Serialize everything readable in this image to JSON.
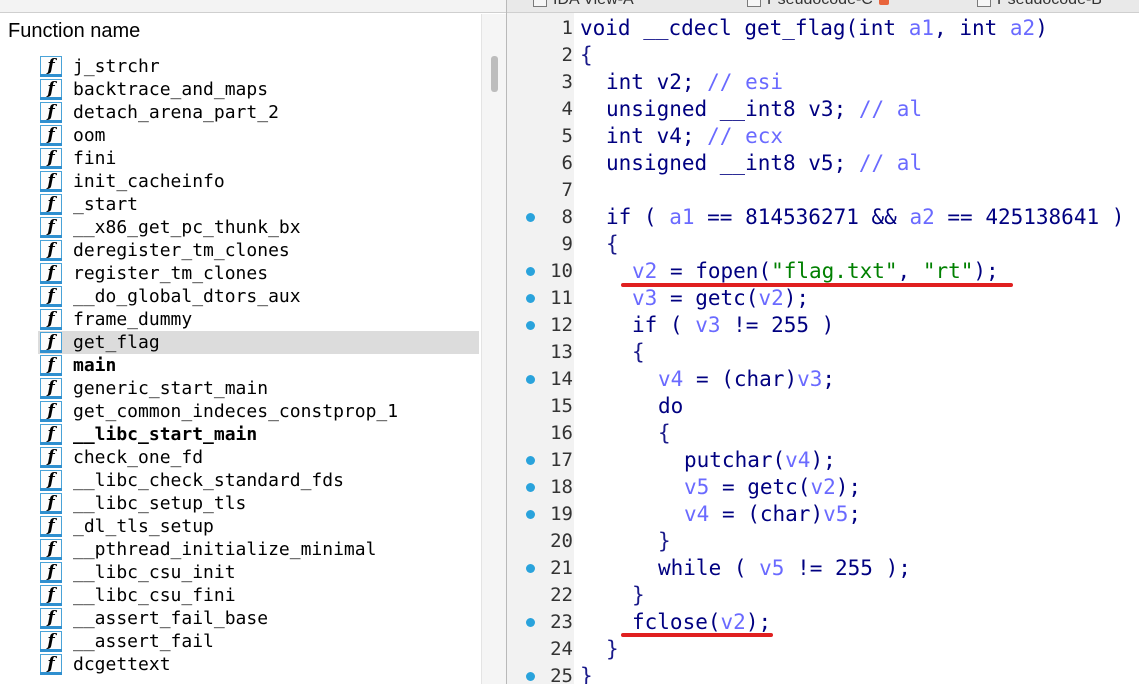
{
  "functions_window": {
    "header": "Function name",
    "icon_glyph": "f",
    "items": [
      {
        "name": "j_strchr",
        "bold": false,
        "selected": false
      },
      {
        "name": "backtrace_and_maps",
        "bold": false,
        "selected": false
      },
      {
        "name": "detach_arena_part_2",
        "bold": false,
        "selected": false
      },
      {
        "name": "oom",
        "bold": false,
        "selected": false
      },
      {
        "name": "fini",
        "bold": false,
        "selected": false
      },
      {
        "name": "init_cacheinfo",
        "bold": false,
        "selected": false
      },
      {
        "name": "_start",
        "bold": false,
        "selected": false
      },
      {
        "name": "__x86_get_pc_thunk_bx",
        "bold": false,
        "selected": false
      },
      {
        "name": "deregister_tm_clones",
        "bold": false,
        "selected": false
      },
      {
        "name": "register_tm_clones",
        "bold": false,
        "selected": false
      },
      {
        "name": "__do_global_dtors_aux",
        "bold": false,
        "selected": false
      },
      {
        "name": "frame_dummy",
        "bold": false,
        "selected": false
      },
      {
        "name": "get_flag",
        "bold": false,
        "selected": true
      },
      {
        "name": "main",
        "bold": true,
        "selected": false
      },
      {
        "name": "generic_start_main",
        "bold": false,
        "selected": false
      },
      {
        "name": "get_common_indeces_constprop_1",
        "bold": false,
        "selected": false
      },
      {
        "name": "__libc_start_main",
        "bold": true,
        "selected": false
      },
      {
        "name": "check_one_fd",
        "bold": false,
        "selected": false
      },
      {
        "name": "__libc_check_standard_fds",
        "bold": false,
        "selected": false
      },
      {
        "name": "__libc_setup_tls",
        "bold": false,
        "selected": false
      },
      {
        "name": "_dl_tls_setup",
        "bold": false,
        "selected": false
      },
      {
        "name": "__pthread_initialize_minimal",
        "bold": false,
        "selected": false
      },
      {
        "name": "__libc_csu_init",
        "bold": false,
        "selected": false
      },
      {
        "name": "__libc_csu_fini",
        "bold": false,
        "selected": false
      },
      {
        "name": "__assert_fail_base",
        "bold": false,
        "selected": false
      },
      {
        "name": "__assert_fail",
        "bold": false,
        "selected": false
      },
      {
        "name": "dcgettext",
        "bold": false,
        "selected": false
      }
    ]
  },
  "tabs": [
    {
      "label": "IDA View-A"
    },
    {
      "label": "Pseudocode-C"
    },
    {
      "label": "Pseudocode-B"
    }
  ],
  "pseudocode": {
    "lines": [
      {
        "n": "1",
        "bp": false,
        "indent": 0,
        "tokens": [
          [
            "kw",
            "void __cdecl get_flag(int "
          ],
          [
            "var",
            "a1"
          ],
          [
            "kw",
            ", int "
          ],
          [
            "var",
            "a2"
          ],
          [
            "kw",
            ")"
          ]
        ]
      },
      {
        "n": "2",
        "bp": false,
        "indent": 0,
        "tokens": [
          [
            "pn",
            "{"
          ]
        ]
      },
      {
        "n": "3",
        "bp": false,
        "indent": 1,
        "tokens": [
          [
            "kw",
            "int v2; "
          ],
          [
            "cm",
            "// esi"
          ]
        ]
      },
      {
        "n": "4",
        "bp": false,
        "indent": 1,
        "tokens": [
          [
            "kw",
            "unsigned __int8 v3; "
          ],
          [
            "cm",
            "// al"
          ]
        ]
      },
      {
        "n": "5",
        "bp": false,
        "indent": 1,
        "tokens": [
          [
            "kw",
            "int v4; "
          ],
          [
            "cm",
            "// ecx"
          ]
        ]
      },
      {
        "n": "6",
        "bp": false,
        "indent": 1,
        "tokens": [
          [
            "kw",
            "unsigned __int8 v5; "
          ],
          [
            "cm",
            "// al"
          ]
        ]
      },
      {
        "n": "7",
        "bp": false,
        "indent": 0,
        "tokens": []
      },
      {
        "n": "8",
        "bp": true,
        "indent": 1,
        "tokens": [
          [
            "kw",
            "if ( "
          ],
          [
            "var",
            "a1"
          ],
          [
            "kw",
            " == 814536271 && "
          ],
          [
            "var",
            "a2"
          ],
          [
            "kw",
            " == 425138641 )"
          ]
        ]
      },
      {
        "n": "9",
        "bp": false,
        "indent": 1,
        "tokens": [
          [
            "pn",
            "{"
          ]
        ]
      },
      {
        "n": "10",
        "bp": true,
        "indent": 2,
        "tokens": [
          [
            "var",
            "v2"
          ],
          [
            "kw",
            " = fopen("
          ],
          [
            "str",
            "\"flag.txt\""
          ],
          [
            "kw",
            ", "
          ],
          [
            "str",
            "\"rt\""
          ],
          [
            "kw",
            ");"
          ]
        ]
      },
      {
        "n": "11",
        "bp": true,
        "indent": 2,
        "tokens": [
          [
            "var",
            "v3"
          ],
          [
            "kw",
            " = getc("
          ],
          [
            "var",
            "v2"
          ],
          [
            "kw",
            ");"
          ]
        ]
      },
      {
        "n": "12",
        "bp": true,
        "indent": 2,
        "tokens": [
          [
            "kw",
            "if ( "
          ],
          [
            "var",
            "v3"
          ],
          [
            "kw",
            " != 255 )"
          ]
        ]
      },
      {
        "n": "13",
        "bp": false,
        "indent": 2,
        "tokens": [
          [
            "pn",
            "{"
          ]
        ]
      },
      {
        "n": "14",
        "bp": true,
        "indent": 3,
        "tokens": [
          [
            "var",
            "v4"
          ],
          [
            "kw",
            " = (char)"
          ],
          [
            "var",
            "v3"
          ],
          [
            "kw",
            ";"
          ]
        ]
      },
      {
        "n": "15",
        "bp": false,
        "indent": 3,
        "tokens": [
          [
            "kw",
            "do"
          ]
        ]
      },
      {
        "n": "16",
        "bp": false,
        "indent": 3,
        "tokens": [
          [
            "pn",
            "{"
          ]
        ]
      },
      {
        "n": "17",
        "bp": true,
        "indent": 4,
        "tokens": [
          [
            "kw",
            "putchar("
          ],
          [
            "var",
            "v4"
          ],
          [
            "kw",
            ");"
          ]
        ]
      },
      {
        "n": "18",
        "bp": true,
        "indent": 4,
        "tokens": [
          [
            "var",
            "v5"
          ],
          [
            "kw",
            " = getc("
          ],
          [
            "var",
            "v2"
          ],
          [
            "kw",
            ");"
          ]
        ]
      },
      {
        "n": "19",
        "bp": true,
        "indent": 4,
        "tokens": [
          [
            "var",
            "v4"
          ],
          [
            "kw",
            " = (char)"
          ],
          [
            "var",
            "v5"
          ],
          [
            "kw",
            ";"
          ]
        ]
      },
      {
        "n": "20",
        "bp": false,
        "indent": 3,
        "tokens": [
          [
            "pn",
            "}"
          ]
        ]
      },
      {
        "n": "21",
        "bp": true,
        "indent": 3,
        "tokens": [
          [
            "kw",
            "while ( "
          ],
          [
            "var",
            "v5"
          ],
          [
            "kw",
            " != 255 );"
          ]
        ]
      },
      {
        "n": "22",
        "bp": false,
        "indent": 2,
        "tokens": [
          [
            "pn",
            "}"
          ]
        ]
      },
      {
        "n": "23",
        "bp": true,
        "indent": 2,
        "tokens": [
          [
            "kw",
            "fclose("
          ],
          [
            "var",
            "v2"
          ],
          [
            "kw",
            ");"
          ]
        ]
      },
      {
        "n": "24",
        "bp": false,
        "indent": 1,
        "tokens": [
          [
            "pn",
            "}"
          ]
        ]
      },
      {
        "n": "25",
        "bp": true,
        "indent": 0,
        "tokens": [
          [
            "pn",
            "}"
          ]
        ]
      }
    ],
    "annotation_color": "#e02020"
  }
}
